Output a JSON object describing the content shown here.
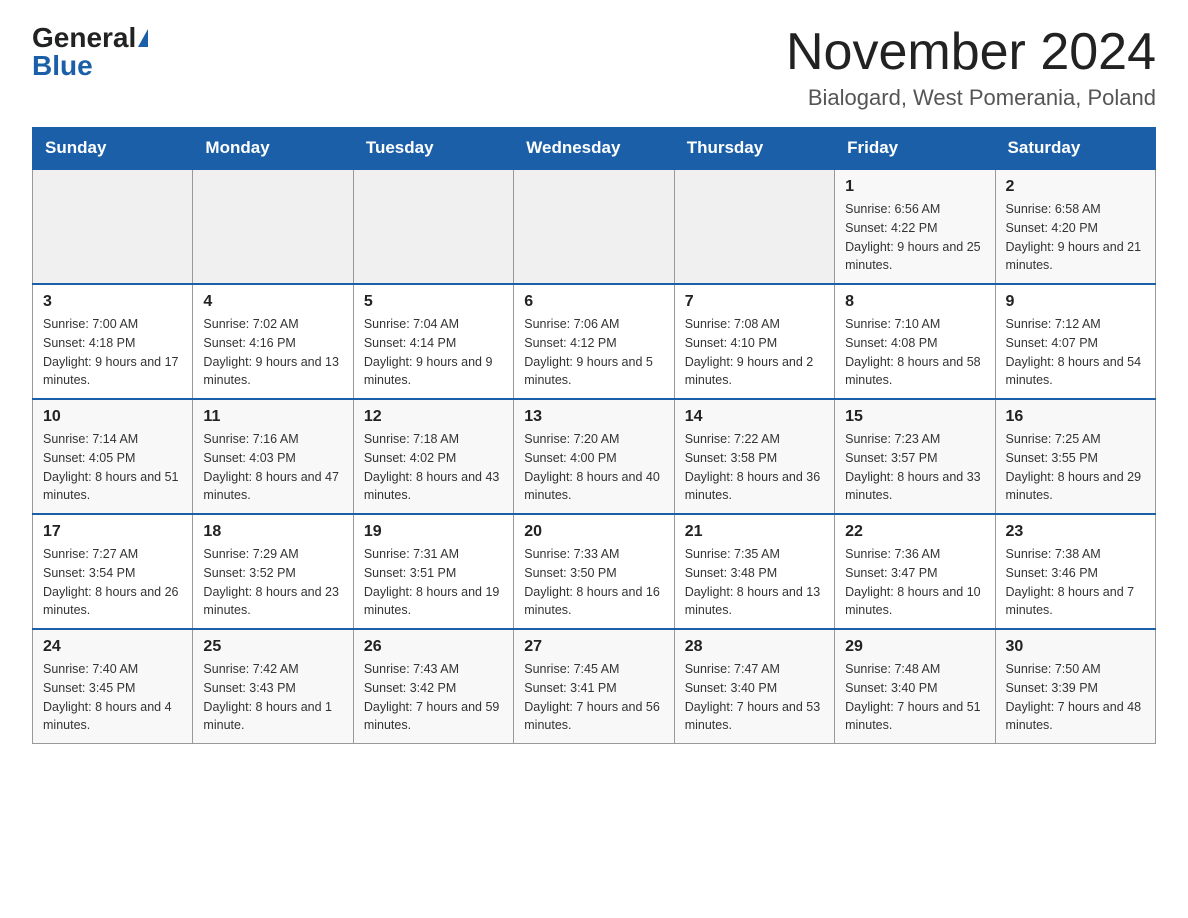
{
  "logo": {
    "general": "General",
    "blue": "Blue"
  },
  "header": {
    "month": "November 2024",
    "location": "Bialogard, West Pomerania, Poland"
  },
  "weekdays": [
    "Sunday",
    "Monday",
    "Tuesday",
    "Wednesday",
    "Thursday",
    "Friday",
    "Saturday"
  ],
  "weeks": [
    [
      {
        "day": "",
        "sunrise": "",
        "sunset": "",
        "daylight": ""
      },
      {
        "day": "",
        "sunrise": "",
        "sunset": "",
        "daylight": ""
      },
      {
        "day": "",
        "sunrise": "",
        "sunset": "",
        "daylight": ""
      },
      {
        "day": "",
        "sunrise": "",
        "sunset": "",
        "daylight": ""
      },
      {
        "day": "",
        "sunrise": "",
        "sunset": "",
        "daylight": ""
      },
      {
        "day": "1",
        "sunrise": "Sunrise: 6:56 AM",
        "sunset": "Sunset: 4:22 PM",
        "daylight": "Daylight: 9 hours and 25 minutes."
      },
      {
        "day": "2",
        "sunrise": "Sunrise: 6:58 AM",
        "sunset": "Sunset: 4:20 PM",
        "daylight": "Daylight: 9 hours and 21 minutes."
      }
    ],
    [
      {
        "day": "3",
        "sunrise": "Sunrise: 7:00 AM",
        "sunset": "Sunset: 4:18 PM",
        "daylight": "Daylight: 9 hours and 17 minutes."
      },
      {
        "day": "4",
        "sunrise": "Sunrise: 7:02 AM",
        "sunset": "Sunset: 4:16 PM",
        "daylight": "Daylight: 9 hours and 13 minutes."
      },
      {
        "day": "5",
        "sunrise": "Sunrise: 7:04 AM",
        "sunset": "Sunset: 4:14 PM",
        "daylight": "Daylight: 9 hours and 9 minutes."
      },
      {
        "day": "6",
        "sunrise": "Sunrise: 7:06 AM",
        "sunset": "Sunset: 4:12 PM",
        "daylight": "Daylight: 9 hours and 5 minutes."
      },
      {
        "day": "7",
        "sunrise": "Sunrise: 7:08 AM",
        "sunset": "Sunset: 4:10 PM",
        "daylight": "Daylight: 9 hours and 2 minutes."
      },
      {
        "day": "8",
        "sunrise": "Sunrise: 7:10 AM",
        "sunset": "Sunset: 4:08 PM",
        "daylight": "Daylight: 8 hours and 58 minutes."
      },
      {
        "day": "9",
        "sunrise": "Sunrise: 7:12 AM",
        "sunset": "Sunset: 4:07 PM",
        "daylight": "Daylight: 8 hours and 54 minutes."
      }
    ],
    [
      {
        "day": "10",
        "sunrise": "Sunrise: 7:14 AM",
        "sunset": "Sunset: 4:05 PM",
        "daylight": "Daylight: 8 hours and 51 minutes."
      },
      {
        "day": "11",
        "sunrise": "Sunrise: 7:16 AM",
        "sunset": "Sunset: 4:03 PM",
        "daylight": "Daylight: 8 hours and 47 minutes."
      },
      {
        "day": "12",
        "sunrise": "Sunrise: 7:18 AM",
        "sunset": "Sunset: 4:02 PM",
        "daylight": "Daylight: 8 hours and 43 minutes."
      },
      {
        "day": "13",
        "sunrise": "Sunrise: 7:20 AM",
        "sunset": "Sunset: 4:00 PM",
        "daylight": "Daylight: 8 hours and 40 minutes."
      },
      {
        "day": "14",
        "sunrise": "Sunrise: 7:22 AM",
        "sunset": "Sunset: 3:58 PM",
        "daylight": "Daylight: 8 hours and 36 minutes."
      },
      {
        "day": "15",
        "sunrise": "Sunrise: 7:23 AM",
        "sunset": "Sunset: 3:57 PM",
        "daylight": "Daylight: 8 hours and 33 minutes."
      },
      {
        "day": "16",
        "sunrise": "Sunrise: 7:25 AM",
        "sunset": "Sunset: 3:55 PM",
        "daylight": "Daylight: 8 hours and 29 minutes."
      }
    ],
    [
      {
        "day": "17",
        "sunrise": "Sunrise: 7:27 AM",
        "sunset": "Sunset: 3:54 PM",
        "daylight": "Daylight: 8 hours and 26 minutes."
      },
      {
        "day": "18",
        "sunrise": "Sunrise: 7:29 AM",
        "sunset": "Sunset: 3:52 PM",
        "daylight": "Daylight: 8 hours and 23 minutes."
      },
      {
        "day": "19",
        "sunrise": "Sunrise: 7:31 AM",
        "sunset": "Sunset: 3:51 PM",
        "daylight": "Daylight: 8 hours and 19 minutes."
      },
      {
        "day": "20",
        "sunrise": "Sunrise: 7:33 AM",
        "sunset": "Sunset: 3:50 PM",
        "daylight": "Daylight: 8 hours and 16 minutes."
      },
      {
        "day": "21",
        "sunrise": "Sunrise: 7:35 AM",
        "sunset": "Sunset: 3:48 PM",
        "daylight": "Daylight: 8 hours and 13 minutes."
      },
      {
        "day": "22",
        "sunrise": "Sunrise: 7:36 AM",
        "sunset": "Sunset: 3:47 PM",
        "daylight": "Daylight: 8 hours and 10 minutes."
      },
      {
        "day": "23",
        "sunrise": "Sunrise: 7:38 AM",
        "sunset": "Sunset: 3:46 PM",
        "daylight": "Daylight: 8 hours and 7 minutes."
      }
    ],
    [
      {
        "day": "24",
        "sunrise": "Sunrise: 7:40 AM",
        "sunset": "Sunset: 3:45 PM",
        "daylight": "Daylight: 8 hours and 4 minutes."
      },
      {
        "day": "25",
        "sunrise": "Sunrise: 7:42 AM",
        "sunset": "Sunset: 3:43 PM",
        "daylight": "Daylight: 8 hours and 1 minute."
      },
      {
        "day": "26",
        "sunrise": "Sunrise: 7:43 AM",
        "sunset": "Sunset: 3:42 PM",
        "daylight": "Daylight: 7 hours and 59 minutes."
      },
      {
        "day": "27",
        "sunrise": "Sunrise: 7:45 AM",
        "sunset": "Sunset: 3:41 PM",
        "daylight": "Daylight: 7 hours and 56 minutes."
      },
      {
        "day": "28",
        "sunrise": "Sunrise: 7:47 AM",
        "sunset": "Sunset: 3:40 PM",
        "daylight": "Daylight: 7 hours and 53 minutes."
      },
      {
        "day": "29",
        "sunrise": "Sunrise: 7:48 AM",
        "sunset": "Sunset: 3:40 PM",
        "daylight": "Daylight: 7 hours and 51 minutes."
      },
      {
        "day": "30",
        "sunrise": "Sunrise: 7:50 AM",
        "sunset": "Sunset: 3:39 PM",
        "daylight": "Daylight: 7 hours and 48 minutes."
      }
    ]
  ]
}
